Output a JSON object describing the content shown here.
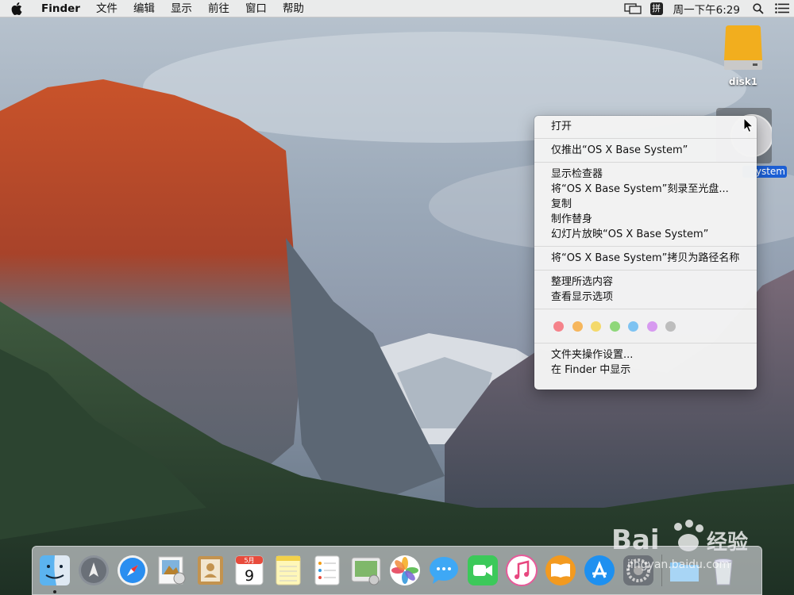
{
  "menubar": {
    "app_name": "Finder",
    "items": [
      "文件",
      "编辑",
      "显示",
      "前往",
      "窗口",
      "帮助"
    ],
    "ime_label": "拼",
    "clock": "周一下午6:29"
  },
  "desktop": {
    "disk1_label": "disk1",
    "osx_label": "ystem"
  },
  "context_menu": {
    "group1": [
      "打开"
    ],
    "group2": [
      "仅推出“OS X Base System”"
    ],
    "group3": [
      "显示检查器",
      "将“OS X Base System”刻录至光盘...",
      "复制",
      "制作替身",
      "幻灯片放映“OS X Base System”"
    ],
    "group4": [
      "将“OS X Base System”拷贝为路径名称"
    ],
    "group5": [
      "整理所选内容",
      "查看显示选项"
    ],
    "tag_colors": [
      "#f5828a",
      "#f6b65c",
      "#f4d96b",
      "#8fd77a",
      "#7ec3f2",
      "#d79af0",
      "#bdbdbd"
    ],
    "group6": [
      "文件夹操作设置...",
      "在 Finder 中显示"
    ]
  },
  "dock": {
    "apps": [
      "finder-icon",
      "launchpad-icon",
      "safari-icon",
      "preview-icon",
      "contacts-icon",
      "calendar-icon",
      "notes-icon",
      "reminders-icon",
      "photo-booth-icon",
      "photos-icon",
      "messages-icon",
      "facetime-icon",
      "itunes-icon",
      "ibooks-icon",
      "app-store-icon",
      "system-preferences-icon"
    ],
    "calendar_month": "5月",
    "calendar_day": "9"
  },
  "watermark": {
    "brand": "Bai",
    "brand_cn": "经验",
    "url": "jingyan.baidu.com"
  }
}
